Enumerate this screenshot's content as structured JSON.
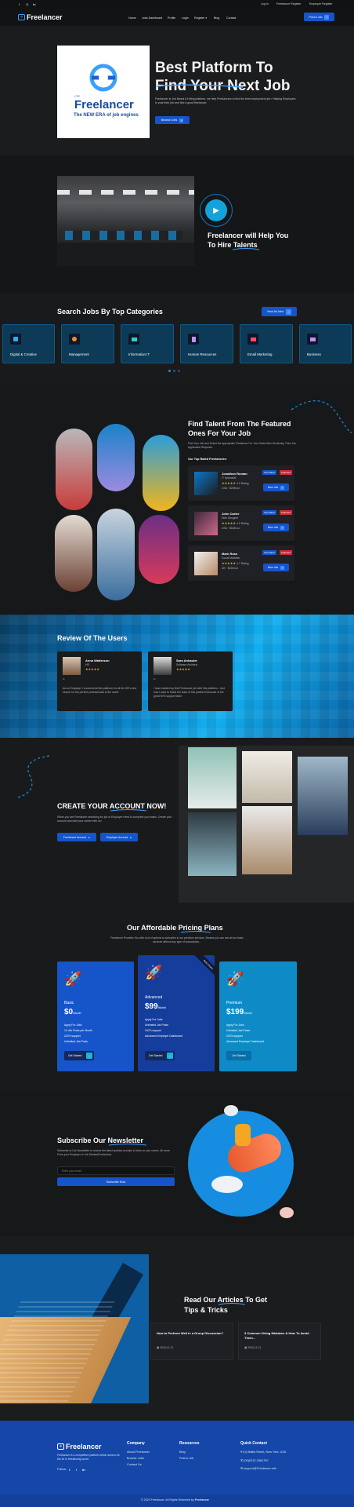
{
  "topbar": {
    "social": [
      "facebook-icon",
      "instagram-icon",
      "linkedin-icon"
    ],
    "links": [
      "Log In",
      "Freelancer Register",
      "Employer Register"
    ]
  },
  "header": {
    "logo": "Freelancer",
    "nav": [
      "Home",
      "Jobs Dashboard",
      "Profile",
      "Login",
      "Register",
      "Blog",
      "Contact"
    ],
    "post_job": "Post A Job"
  },
  "hero": {
    "title_line1": "Best Platform To",
    "title_line2": "Find Your Next Job",
    "paragraph": "Freelancer is Job Board & Hiring platform, we help Freelancers to find the best employment job / Helping Employers to post their job and find a good freelancer.",
    "browse_button": "Browse Jobs",
    "logo_kicker": "LTE",
    "logo_name": "Freelancer",
    "logo_tagline": "The NEW ERA of job engines"
  },
  "video": {
    "title_line1": "Freelancer will Help You",
    "title_line2": "To Hire Talents"
  },
  "categories": {
    "title": "Search Jobs By Top Categories",
    "view_all": "View All Jobs",
    "items": [
      "Digital & Creative",
      "Management",
      "Information IT",
      "Human Resources",
      "Email Marketing",
      "Business"
    ]
  },
  "talent": {
    "title_line1": "Find Talent From The Featured",
    "title_line2": "Ones For Your Job",
    "subtitle": "Post Your Job and Select the appropriate Freelancer For Your Tasks After Reviewing Their Job Application Requests",
    "top_rated": "Our Top Rated Freelancers:",
    "freelancers": [
      {
        "name": "Jonathon Roman",
        "role": "IT Specialist",
        "rating": "4.9 Rating",
        "badge1": "Top Rated",
        "badge2": "Featured",
        "loc": "USA",
        "rate": "$20/hour",
        "button": "More Info"
      },
      {
        "name": "John Carter",
        "role": "Web Designer",
        "rating": "4.9 Rating",
        "badge1": "Top Rated",
        "badge2": "Featured",
        "loc": "USA",
        "rate": "$18/hour",
        "button": "More Info"
      },
      {
        "name": "Mark Rose",
        "role": "Social Marketer",
        "rating": "4.7 Rating",
        "badge1": "Top Rated",
        "badge2": "Featured",
        "loc": "UK",
        "rate": "$15/hour",
        "button": "More Info"
      }
    ]
  },
  "reviews": {
    "title": "Review Of The Users",
    "items": [
      {
        "name": "Anna Watterson",
        "role": "HR",
        "text": "As an Employer I recommend this platform for all the HR's who search for the perfect professionals in the world"
      },
      {
        "name": "Sara Anhauler",
        "role": "Software Architect",
        "text": "I have started my first Freelancer job with this platform... And now I want to thank the team of this platform because of the great 90% support team"
      }
    ]
  },
  "account": {
    "title": "CREATE YOUR ACCOUNT NOW!",
    "paragraph": "Either you are Freelancer searching for job or Employer need to complete your tasks, Create your account and start your career with us!",
    "freelancer_btn": "Freelancer Account",
    "employer_btn": "Employer Account"
  },
  "pricing": {
    "title": "Our Affordable Pricing Plans",
    "subtitle": "Freelancer Provides You with a lot of options to subscribe in our premium services, Browse you can see all our basic services without any type of subscription...",
    "plans": [
      {
        "name": "Basic",
        "price": "$0",
        "period": "/Month",
        "features": [
          "Apply For Jobs",
          "10 Job Posts per Month",
          "24/7h support",
          "Unlimited Job Posts"
        ],
        "button": "Get Started"
      },
      {
        "name": "Advanced",
        "price": "$99",
        "period": "/Month",
        "features": [
          "Apply For Jobs",
          "Unlimited Job Posts",
          "24/7h support",
          "Advanced Employer Dashboard"
        ],
        "button": "Get Started",
        "ribbon": "Best Choice"
      },
      {
        "name": "Premium",
        "price": "$199",
        "period": "/Month",
        "features": [
          "Apply For Jobs",
          "Unlimited Job Posts",
          "24/7h support",
          "Advanced Employer Dashboard"
        ],
        "button": "Get Started"
      }
    ]
  },
  "newsletter": {
    "title": "Subscribe Our Newsletter",
    "paragraph": "Subscribe to Our Newsletter to receive the latest updates and tips & tricks on your career. All come From your Employer or Job Seeker(Freelancer).",
    "placeholder": "Enter your email",
    "button": "Subscribe Now"
  },
  "articles": {
    "title_line1": "Read Our Articles To Get",
    "title_line2": "Tips & Tricks",
    "items": [
      {
        "title": "How to Perform Well in a Group Discussion?",
        "date": "2023-11-11"
      },
      {
        "title": "3 Common Hiring Mistakes & How To Avoid Them...",
        "date": "2023-11-11"
      }
    ]
  },
  "footer": {
    "logo": "Freelancer",
    "about": "Freelancer is a competitive platform which aims to be the #1 in freelancing world.",
    "follow": "Follow:",
    "company_title": "Company",
    "company_links": [
      "About Freelancer",
      "Browse Jobs",
      "Contact Us"
    ],
    "resources_title": "Resources",
    "resources_links": [
      "Blog",
      "Post A Job"
    ],
    "contact_title": "Quick Contact",
    "contact": [
      "(0) Wallst Street, New York, USA",
      "(00)0212-2581752",
      "support@Freelancer.info"
    ],
    "copyright": "© 2023 Freelancer. All Rights Reserved by",
    "copyright_brand": "Freelancer"
  }
}
